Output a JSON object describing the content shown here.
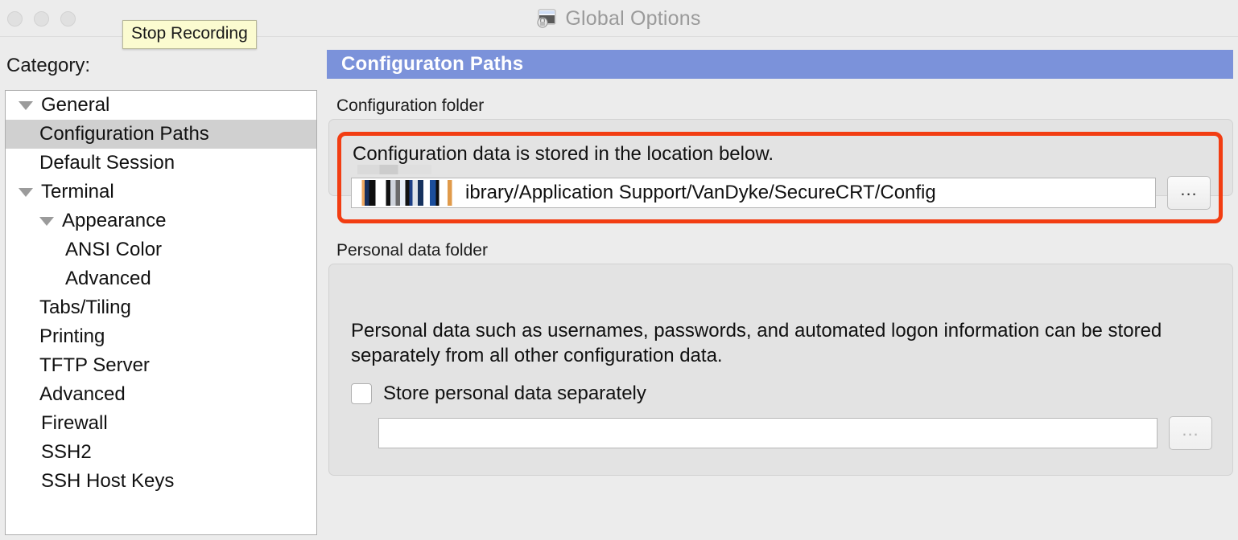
{
  "window": {
    "title": "Global Options",
    "title_icon": "terminal-lock-icon",
    "traffic_lights": [
      "close-button",
      "minimize-button",
      "zoom-button"
    ]
  },
  "tooltip": {
    "label": "Stop Recording"
  },
  "sidebar": {
    "label": "Category:",
    "items": [
      {
        "label": "General",
        "level": 0,
        "twisty": "expanded",
        "selected": false
      },
      {
        "label": "Configuration Paths",
        "level": 1,
        "twisty": "none",
        "selected": true
      },
      {
        "label": "Default Session",
        "level": 1,
        "twisty": "none",
        "selected": false
      },
      {
        "label": "Terminal",
        "level": 0,
        "twisty": "expanded",
        "selected": false
      },
      {
        "label": "Appearance",
        "level": 1,
        "twisty": "expanded",
        "selected": false
      },
      {
        "label": "ANSI Color",
        "level": 2,
        "twisty": "none",
        "selected": false
      },
      {
        "label": "Advanced",
        "level": 2,
        "twisty": "none",
        "selected": false
      },
      {
        "label": "Tabs/Tiling",
        "level": 1,
        "twisty": "none",
        "selected": false
      },
      {
        "label": "Printing",
        "level": 1,
        "twisty": "none",
        "selected": false
      },
      {
        "label": "TFTP Server",
        "level": 1,
        "twisty": "none",
        "selected": false
      },
      {
        "label": "Advanced",
        "level": 1,
        "twisty": "none",
        "selected": false
      },
      {
        "label": "Firewall",
        "level": 0,
        "twisty": "none",
        "selected": false
      },
      {
        "label": "SSH2",
        "level": 0,
        "twisty": "none",
        "selected": false
      },
      {
        "label": "SSH Host Keys",
        "level": 0,
        "twisty": "none",
        "selected": false
      }
    ]
  },
  "panel": {
    "header_title": "Configuraton Paths",
    "configuration_folder": {
      "group_label": "Configuration folder",
      "description": "Configuration data is stored in the location below.",
      "path_value": "ibrary/Application Support/VanDyke/SecureCRT/Config",
      "path_prefix_redacted": true,
      "browse_label": "..."
    },
    "personal_data_folder": {
      "group_label": "Personal data folder",
      "description": "Personal data such as usernames, passwords, and automated logon information can be stored separately from all other configuration data.",
      "checkbox_label": "Store personal data separately",
      "checkbox_checked": false,
      "path_value": "",
      "browse_label": "...",
      "browse_disabled": true
    }
  },
  "colors": {
    "header_blue": "#7b92da",
    "annotation_red": "#f23d12",
    "selection_gray": "#d0d0d0",
    "tooltip_yellow": "#fbfbd0",
    "window_bg": "#ececec"
  },
  "annotation": {
    "shape": "rounded-rectangle",
    "target": "configuration-folder-path-area"
  }
}
